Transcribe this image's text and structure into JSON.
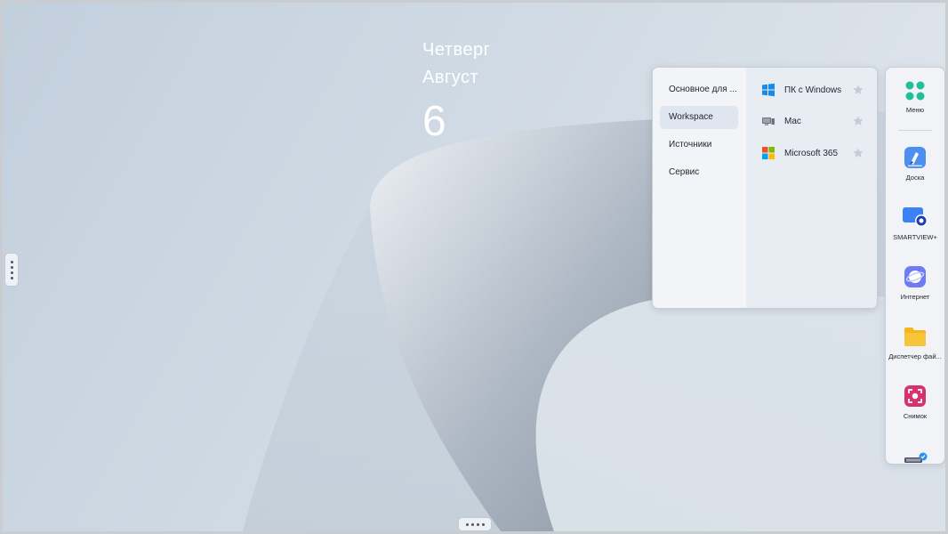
{
  "clock": {
    "weekday": "Четверг",
    "month": "Август",
    "day": "6"
  },
  "flyout": {
    "categories": [
      {
        "label": "Основное для ..."
      },
      {
        "label": "Workspace",
        "selected": true
      },
      {
        "label": "Источники"
      },
      {
        "label": "Сервис"
      }
    ],
    "apps": [
      {
        "label": "ПК с Windows",
        "icon": "windows-logo-icon"
      },
      {
        "label": "Mac",
        "icon": "mac-computer-icon"
      },
      {
        "label": "Microsoft 365",
        "icon": "microsoft-365-logo-icon"
      }
    ]
  },
  "dock": {
    "items": [
      {
        "label": "Меню",
        "icon": "menu-dots-icon"
      },
      {
        "label": "Доска",
        "icon": "whiteboard-icon"
      },
      {
        "label": "SMARTVIEW+",
        "icon": "smartview-icon"
      },
      {
        "label": "Интернет",
        "icon": "internet-browser-icon"
      },
      {
        "label": "Диспетчер фай...",
        "icon": "folder-icon"
      },
      {
        "label": "Снимок",
        "icon": "screenshot-icon"
      },
      {
        "label": "",
        "icon": "connected-device-icon"
      }
    ]
  },
  "colors": {
    "accent_teal": "#1fbf9a",
    "folder_yellow": "#f4b71b",
    "screenshot_pink": "#d6336c",
    "smartview_blue": "#3b82f6"
  }
}
